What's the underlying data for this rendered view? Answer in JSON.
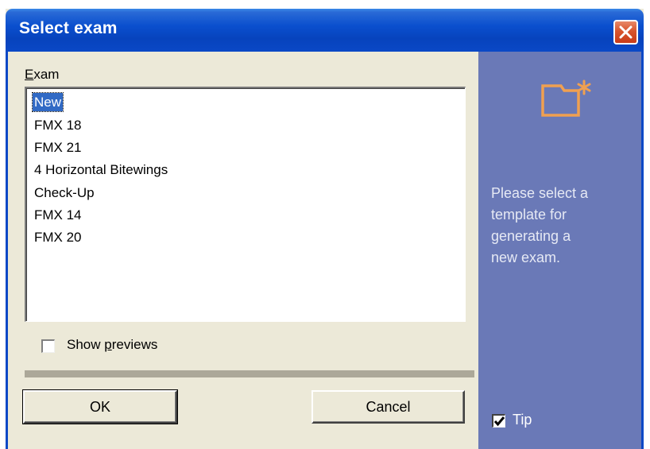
{
  "window": {
    "title": "Select exam"
  },
  "exam": {
    "label_accel": "E",
    "label_rest": "xam",
    "items": [
      "New",
      "FMX 18",
      "FMX 21",
      "4 Horizontal Bitewings",
      "Check-Up",
      "FMX 14",
      "FMX 20"
    ],
    "selected_index": 0
  },
  "show_previews": {
    "label_pre": "Show ",
    "label_accel": "p",
    "label_post": "reviews",
    "checked": false
  },
  "buttons": {
    "ok_label": "OK",
    "cancel_label": "Cancel"
  },
  "side_panel": {
    "icon": "new-folder-icon",
    "tip_lines": [
      "Please select a",
      "template for",
      "generating a",
      "new exam."
    ],
    "tip_checkbox_label": "Tip",
    "tip_checked": true
  },
  "colors": {
    "title_bar": "#0a4fce",
    "close_button": "#d8552d",
    "side_panel": "#6a79b7",
    "selection": "#316ac5",
    "folder_icon": "#f0a050"
  }
}
